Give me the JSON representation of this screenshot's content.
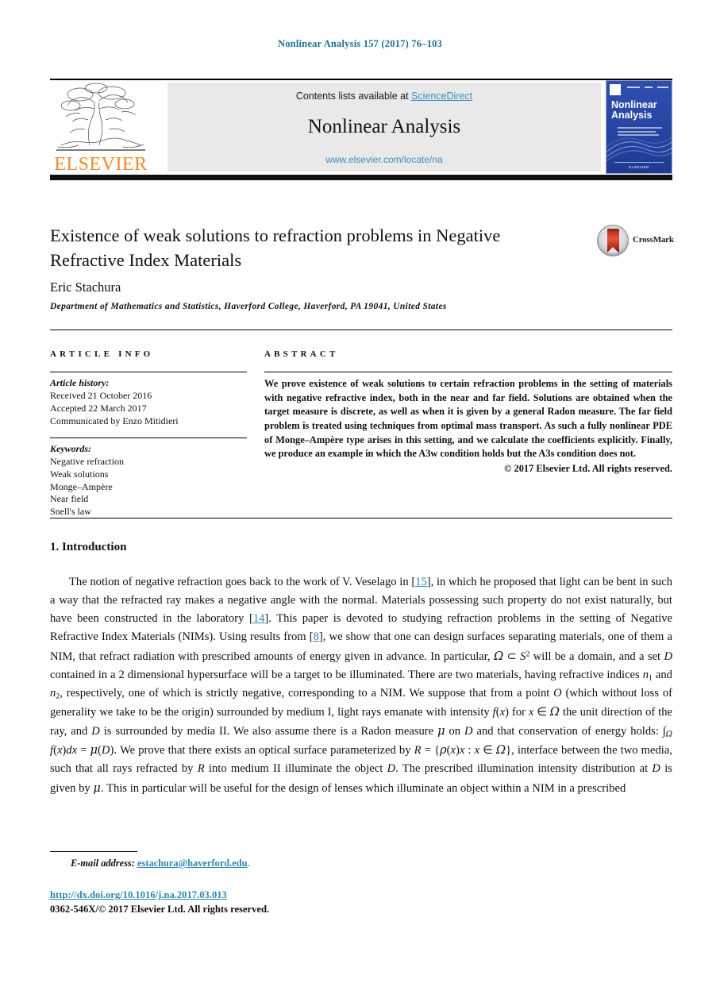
{
  "running_head": "Nonlinear Analysis 157 (2017) 76–103",
  "masthead": {
    "publisher_name": "ELSEVIER",
    "publisher_logo_icon": "elsevier-tree-icon",
    "contents_prefix": "Contents lists available at ",
    "contents_link": "ScienceDirect",
    "journal_name": "Nonlinear Analysis",
    "journal_url": "www.elsevier.com/locate/na",
    "cover": {
      "title_line1": "Nonlinear",
      "title_line2": "Analysis",
      "footer_text": "ELSEVIER"
    }
  },
  "article": {
    "title": "Existence of weak solutions to refraction problems in Negative Refractive Index Materials",
    "author": "Eric Stachura",
    "affiliation": "Department of Mathematics and Statistics, Haverford College, Haverford, PA 19041, United States",
    "crossmark_label": "CrossMark",
    "crossmark_icon": "crossmark-icon"
  },
  "article_info": {
    "heading": "ARTICLE INFO",
    "history_heading": "Article history:",
    "history_lines": [
      "Received 21 October 2016",
      "Accepted 22 March 2017",
      "Communicated by Enzo Mitidieri"
    ],
    "keywords_heading": "Keywords:",
    "keywords": [
      "Negative refraction",
      "Weak solutions",
      "Monge–Ampère",
      "Near field",
      "Snell's law"
    ]
  },
  "abstract": {
    "heading": "ABSTRACT",
    "body": "We prove existence of weak solutions to certain refraction problems in the setting of materials with negative refractive index, both in the near and far field. Solutions are obtained when the target measure is discrete, as well as when it is given by a general Radon measure. The far field problem is treated using techniques from optimal mass transport. As such a fully nonlinear PDE of Monge–Ampère type arises in this setting, and we calculate the coefficients explicitly. Finally, we produce an example in which the A3w condition holds but the A3s condition does not.",
    "copyright": "© 2017 Elsevier Ltd. All rights reserved."
  },
  "introduction": {
    "heading": "1. Introduction",
    "paragraph_html": "The notion of negative refraction goes back to the work of V. Veselago in [<a class=\"ref-link\" href=\"#\" data-name=\"citation-link-15\" data-interactable=\"true\">15</a>], in which he proposed that light can be bent in such a way that the refracted ray makes a negative angle with the normal. Materials possessing such property do not exist naturally, but have been constructed in the laboratory [<a class=\"ref-link\" href=\"#\" data-name=\"citation-link-14\" data-interactable=\"true\">14</a>]. This paper is devoted to studying refraction problems in the setting of Negative Refractive Index Materials (NIMs). Using results from [<a class=\"ref-link\" href=\"#\" data-name=\"citation-link-8\" data-interactable=\"true\">8</a>], we show that one can design surfaces separating materials, one of them a NIM, that refract radiation with prescribed amounts of energy given in advance. In particular, <span class=\"mathsym\">Ω</span> &#8834; <em class=\"mathit\">S</em><sup>2</sup> will be a domain, and a set <em class=\"mathit\">D</em> contained in a 2 dimensional hypersurface will be a target to be illuminated. There are two materials, having refractive indices <em class=\"mathit\">n</em><sub>1</sub> and <em class=\"mathit\">n</em><sub>2</sub>, respectively, one of which is strictly negative, corresponding to a NIM. We suppose that from a point <em class=\"mathit\">O</em> (which without loss of generality we take to be the origin) surrounded by medium I, light rays emanate with intensity <em class=\"mathit\">f</em>(<em class=\"mathit\">x</em>) for <em class=\"mathit\">x</em> &#8712; <span class=\"mathsym\">Ω</span> the unit direction of the ray, and <em class=\"mathit\">D</em> is surrounded by media II. We also assume there is a Radon measure <span class=\"mathsym\">&#956;</span> on <em class=\"mathit\">D</em> and that conservation of energy holds: &#8747;<sub><span class=\"mathsym\">Ω</span></sub> <em class=\"mathit\">f</em>(<em class=\"mathit\">x</em>)<em class=\"mathit\">dx</em> = <span class=\"mathsym\">&#956;</span>(<em class=\"mathit\">D</em>). We prove that there exists an optical surface parameterized by <em class=\"mathit\">R</em> = {<span class=\"mathsym\">&#961;</span>(<em class=\"mathit\">x</em>)<em class=\"mathit\">x</em> : <em class=\"mathit\">x</em> &#8712; <span class=\"mathsym\">Ω</span>}, interface between the two media, such that all rays refracted by <em class=\"mathit\">R</em> into medium II illuminate the object <em class=\"mathit\">D</em>. The prescribed illumination intensity distribution at <em class=\"mathit\">D</em> is given by <span class=\"mathsym\">&#956;</span>. This in particular will be useful for the design of lenses which illuminate an object within a NIM in a prescribed"
  },
  "footer": {
    "email_label": "E-mail address:",
    "email": "estachura@haverford.edu",
    "email_suffix": ".",
    "doi": "http://dx.doi.org/10.1016/j.na.2017.03.013",
    "issn_line": "0362-546X/© 2017 Elsevier Ltd. All rights reserved."
  },
  "colors": {
    "link_blue": "#2e86b5",
    "running_head_blue": "#1f7099",
    "elsevier_orange": "#f0892a",
    "cover_blue": "#2846a5"
  }
}
